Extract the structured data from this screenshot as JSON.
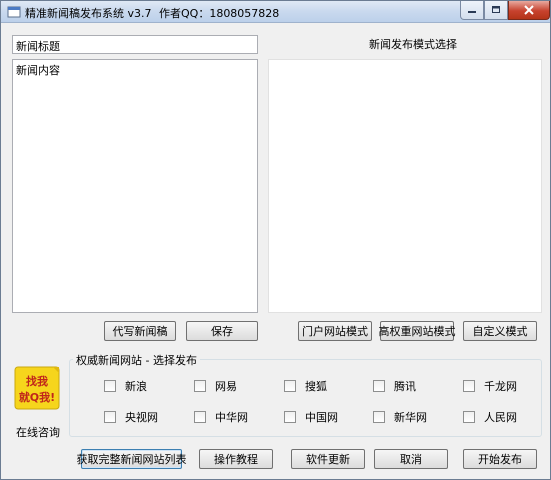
{
  "window": {
    "title": "精准新闻稿发布系统 v3.7",
    "author": "作者QQ：1808057828"
  },
  "editor": {
    "title_value": "新闻标题",
    "content_value": "新闻内容"
  },
  "mode_section": {
    "label": "新闻发布模式选择"
  },
  "buttons": {
    "ghostwrite": "代写新闻稿",
    "save": "保存",
    "portal_mode": "门户网站模式",
    "high_weight_mode": "高权重网站模式",
    "custom_mode": "自定义模式",
    "get_site_list": "获取完整新闻网站列表",
    "tutorial": "操作教程",
    "update": "软件更新",
    "cancel": "取消",
    "publish": "开始发布"
  },
  "sites": {
    "legend": "权威新闻网站 - 选择发布",
    "row1": [
      "新浪",
      "网易",
      "搜狐",
      "腾讯",
      "千龙网"
    ],
    "row2": [
      "央视网",
      "中华网",
      "中国网",
      "新华网",
      "人民网"
    ]
  },
  "logo": {
    "text": "找我就Q我!",
    "caption": "在线咨询"
  },
  "colors": {
    "logo_yellow": "#f6d51c",
    "close_red": "#c7422e"
  },
  "icons": {
    "app": "app-icon",
    "minimize": "minimize-icon",
    "maximize": "maximize-icon",
    "close": "close-icon"
  }
}
